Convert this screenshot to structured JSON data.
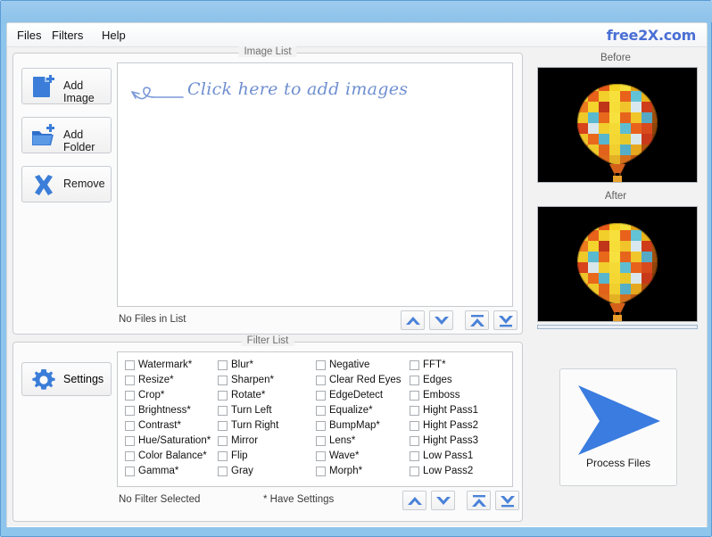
{
  "window": {
    "chrome_color": "#8ec5ec",
    "brand": "free2X.com"
  },
  "menubar": {
    "items": [
      {
        "label": "Files"
      },
      {
        "label": "Filters"
      },
      {
        "label": "Help"
      }
    ]
  },
  "toolbar": {
    "add_image_label": "Add Image",
    "add_folder_label": "Add Folder",
    "remove_label": "Remove",
    "settings_label": "Settings"
  },
  "image_panel": {
    "title": "Image List",
    "hint": "Click here to add images",
    "status": "No Files in List"
  },
  "filter_panel": {
    "title": "Filter List",
    "status": "No Filter Selected",
    "legend": "* Have Settings",
    "columns": [
      [
        {
          "label": "Watermark*",
          "checked": false
        },
        {
          "label": "Resize*",
          "checked": false
        },
        {
          "label": "Crop*",
          "checked": false
        },
        {
          "label": "Brightness*",
          "checked": false
        },
        {
          "label": "Contrast*",
          "checked": false
        },
        {
          "label": "Hue/Saturation*",
          "checked": false
        },
        {
          "label": "Color Balance*",
          "checked": false
        },
        {
          "label": "Gamma*",
          "checked": false
        }
      ],
      [
        {
          "label": "Blur*",
          "checked": false
        },
        {
          "label": "Sharpen*",
          "checked": false
        },
        {
          "label": "Rotate*",
          "checked": false
        },
        {
          "label": "Turn Left",
          "checked": false
        },
        {
          "label": "Turn Right",
          "checked": false
        },
        {
          "label": "Mirror",
          "checked": false
        },
        {
          "label": "Flip",
          "checked": false
        },
        {
          "label": "Gray",
          "checked": false
        }
      ],
      [
        {
          "label": "Negative",
          "checked": false
        },
        {
          "label": "Clear Red Eyes",
          "checked": false
        },
        {
          "label": "EdgeDetect",
          "checked": false
        },
        {
          "label": "Equalize*",
          "checked": false
        },
        {
          "label": "BumpMap*",
          "checked": false
        },
        {
          "label": "Lens*",
          "checked": false
        },
        {
          "label": "Wave*",
          "checked": false
        },
        {
          "label": "Morph*",
          "checked": false
        }
      ],
      [
        {
          "label": "FFT*",
          "checked": false
        },
        {
          "label": "Edges",
          "checked": false
        },
        {
          "label": "Emboss",
          "checked": false
        },
        {
          "label": "Hight Pass1",
          "checked": false
        },
        {
          "label": "Hight Pass2",
          "checked": false
        },
        {
          "label": "Hight Pass3",
          "checked": false
        },
        {
          "label": "Low Pass1",
          "checked": false
        },
        {
          "label": "Low Pass2",
          "checked": false
        }
      ]
    ]
  },
  "order_buttons": [
    {
      "name": "move-up",
      "glyph": "chevron-up"
    },
    {
      "name": "move-down",
      "glyph": "chevron-down"
    },
    {
      "name": "move-to-top",
      "glyph": "chevron-up-bar"
    },
    {
      "name": "move-to-bottom",
      "glyph": "chevron-down-bar"
    }
  ],
  "preview": {
    "before_title": "Before",
    "after_title": "After",
    "image_subject": "hot-air-balloon",
    "background": "#000000",
    "progress_percent": 0
  },
  "process": {
    "label": "Process Files",
    "arrow_color": "#3a7ce0"
  },
  "icons": {
    "add_image": "document-plus-icon",
    "add_folder": "folder-plus-icon",
    "remove": "x-mark-icon",
    "settings": "gear-icon",
    "process": "play-arrow-icon",
    "hint": "curly-arrow-icon"
  }
}
